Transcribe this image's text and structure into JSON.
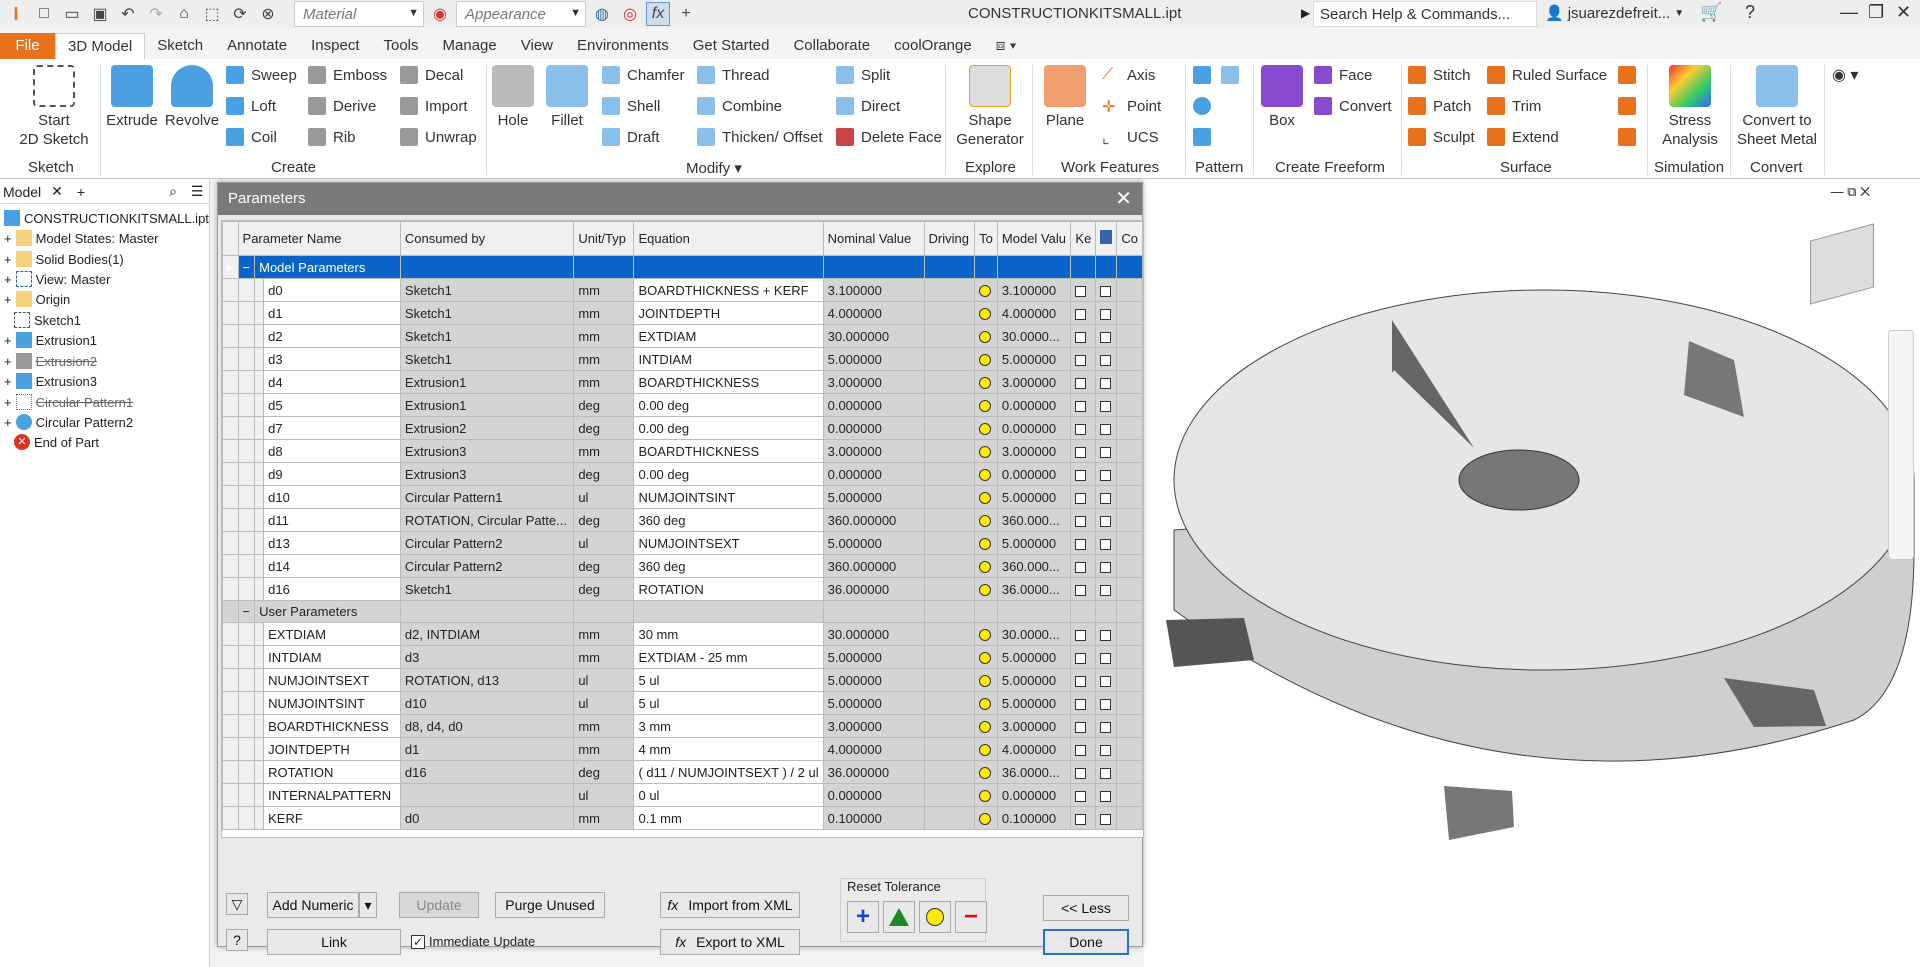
{
  "window": {
    "doc_title": "CONSTRUCTIONKITSMALL.ipt",
    "search_placeholder": "Search Help & Commands...",
    "user": "jsuarezdefreit..."
  },
  "quick_access": {
    "material": "Material",
    "appearance": "Appearance"
  },
  "menu_tabs": [
    "File",
    "3D Model",
    "Sketch",
    "Annotate",
    "Inspect",
    "Tools",
    "Manage",
    "View",
    "Environments",
    "Get Started",
    "Collaborate",
    "coolOrange"
  ],
  "ribbon": {
    "start_sketch": "Start\n2D Sketch",
    "sketch_panel": "Sketch",
    "extrude": "Extrude",
    "revolve": "Revolve",
    "sweep": "Sweep",
    "emboss": "Emboss",
    "decal": "Decal",
    "loft": "Loft",
    "derive": "Derive",
    "import": "Import",
    "coil": "Coil",
    "rib": "Rib",
    "unwrap": "Unwrap",
    "create_panel": "Create",
    "hole": "Hole",
    "fillet": "Fillet",
    "chamfer": "Chamfer",
    "thread": "Thread",
    "shell": "Shell",
    "combine": "Combine",
    "draft": "Draft",
    "thicken": "Thicken/ Offset",
    "split": "Split",
    "direct": "Direct",
    "delete_face": "Delete Face",
    "modify_panel": "Modify",
    "shape_gen": "Shape\nGenerator",
    "explore_panel": "Explore",
    "plane": "Plane",
    "axis": "Axis",
    "point": "Point",
    "ucs": "UCS",
    "work_panel": "Work Features",
    "pattern_panel": "Pattern",
    "box": "Box",
    "face": "Face",
    "convert": "Convert",
    "freeform_panel": "Create Freeform",
    "stitch": "Stitch",
    "ruled": "Ruled Surface",
    "patch": "Patch",
    "trim": "Trim",
    "sculpt": "Sculpt",
    "extend": "Extend",
    "surface_panel": "Surface",
    "stress": "Stress\nAnalysis",
    "sim_panel": "Simulation",
    "convert_sm": "Convert to\nSheet Metal",
    "convert_panel": "Convert"
  },
  "browser": {
    "tab": "Model",
    "items": [
      {
        "label": "CONSTRUCTIONKITSMALL.ipt",
        "strike": false
      },
      {
        "label": "Model States: Master",
        "strike": false
      },
      {
        "label": "Solid Bodies(1)",
        "strike": false
      },
      {
        "label": "View: Master",
        "strike": false
      },
      {
        "label": "Origin",
        "strike": false
      },
      {
        "label": "Sketch1",
        "strike": false
      },
      {
        "label": "Extrusion1",
        "strike": false
      },
      {
        "label": "Extrusion2",
        "strike": true
      },
      {
        "label": "Extrusion3",
        "strike": false
      },
      {
        "label": "Circular Pattern1",
        "strike": true
      },
      {
        "label": "Circular Pattern2",
        "strike": false
      },
      {
        "label": "End of Part",
        "strike": false
      }
    ]
  },
  "dialog": {
    "title": "Parameters",
    "columns": [
      "Parameter Name",
      "Consumed by",
      "Unit/Typ",
      "Equation",
      "Nominal Value",
      "Driving",
      "To",
      "Model Valu",
      "Ke",
      "",
      "Co"
    ],
    "model_group": "Model Parameters",
    "user_group": "User Parameters",
    "model_params": [
      [
        "d0",
        "Sketch1",
        "mm",
        "BOARDTHICKNESS + KERF",
        "3.100000",
        "3.100000"
      ],
      [
        "d1",
        "Sketch1",
        "mm",
        "JOINTDEPTH",
        "4.000000",
        "4.000000"
      ],
      [
        "d2",
        "Sketch1",
        "mm",
        "EXTDIAM",
        "30.000000",
        "30.0000..."
      ],
      [
        "d3",
        "Sketch1",
        "mm",
        "INTDIAM",
        "5.000000",
        "5.000000"
      ],
      [
        "d4",
        "Extrusion1",
        "mm",
        "BOARDTHICKNESS",
        "3.000000",
        "3.000000"
      ],
      [
        "d5",
        "Extrusion1",
        "deg",
        "0.00 deg",
        "0.000000",
        "0.000000"
      ],
      [
        "d7",
        "Extrusion2",
        "deg",
        "0.00 deg",
        "0.000000",
        "0.000000"
      ],
      [
        "d8",
        "Extrusion3",
        "mm",
        "BOARDTHICKNESS",
        "3.000000",
        "3.000000"
      ],
      [
        "d9",
        "Extrusion3",
        "deg",
        "0.00 deg",
        "0.000000",
        "0.000000"
      ],
      [
        "d10",
        "Circular Pattern1",
        "ul",
        "NUMJOINTSINT",
        "5.000000",
        "5.000000"
      ],
      [
        "d11",
        "ROTATION, Circular Patte...",
        "deg",
        "360 deg",
        "360.000000",
        "360.000..."
      ],
      [
        "d13",
        "Circular Pattern2",
        "ul",
        "NUMJOINTSEXT",
        "5.000000",
        "5.000000"
      ],
      [
        "d14",
        "Circular Pattern2",
        "deg",
        "360 deg",
        "360.000000",
        "360.000..."
      ],
      [
        "d16",
        "Sketch1",
        "deg",
        "ROTATION",
        "36.000000",
        "36.0000..."
      ]
    ],
    "user_params": [
      [
        "EXTDIAM",
        "d2, INTDIAM",
        "mm",
        "30 mm",
        "30.000000",
        "30.0000..."
      ],
      [
        "INTDIAM",
        "d3",
        "mm",
        "EXTDIAM - 25 mm",
        "5.000000",
        "5.000000"
      ],
      [
        "NUMJOINTSEXT",
        "ROTATION, d13",
        "ul",
        "5 ul",
        "5.000000",
        "5.000000"
      ],
      [
        "NUMJOINTSINT",
        "d10",
        "ul",
        "5 ul",
        "5.000000",
        "5.000000"
      ],
      [
        "BOARDTHICKNESS",
        "d8, d4, d0",
        "mm",
        "3 mm",
        "3.000000",
        "3.000000"
      ],
      [
        "JOINTDEPTH",
        "d1",
        "mm",
        "4 mm",
        "4.000000",
        "4.000000"
      ],
      [
        "ROTATION",
        "d16",
        "deg",
        "( d11 / NUMJOINTSEXT ) / 2 ul",
        "36.000000",
        "36.0000..."
      ],
      [
        "INTERNALPATTERN",
        "",
        "ul",
        "0 ul",
        "0.000000",
        "0.000000"
      ],
      [
        "KERF",
        "d0",
        "mm",
        "0.1 mm",
        "0.100000",
        "0.100000"
      ]
    ],
    "buttons": {
      "add_numeric": "Add Numeric",
      "update": "Update",
      "purge": "Purge Unused",
      "import_xml": "Import from XML",
      "export_xml": "Export to XML",
      "link": "Link",
      "immediate": "Immediate Update",
      "reset_tol": "Reset Tolerance",
      "less": "<< Less",
      "done": "Done"
    }
  }
}
